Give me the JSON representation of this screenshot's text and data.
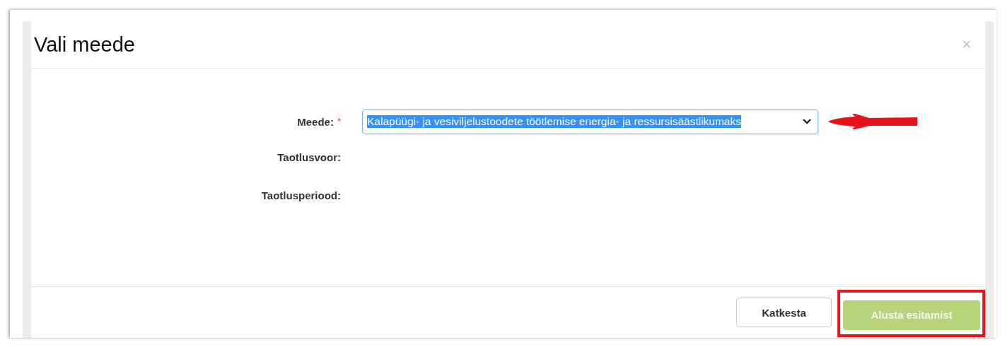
{
  "dialog": {
    "title": "Vali meede",
    "close": "×"
  },
  "fields": [
    {
      "kind": "select",
      "label": "Meede:",
      "required_mark": "*",
      "value": "Kalapüügi- ja vesiviljelustoodete töötlemise energia- ja ressursisäästlikumaks",
      "text_selected": true
    },
    {
      "kind": "text",
      "label": "Taotlusvoor:"
    },
    {
      "kind": "text",
      "label": "Taotlusperiood:"
    }
  ],
  "buttons": [
    {
      "kind": "default",
      "label": "Katkesta",
      "disabled": false
    },
    {
      "kind": "primary",
      "label": "Alusta esitamist",
      "disabled": true
    }
  ]
}
